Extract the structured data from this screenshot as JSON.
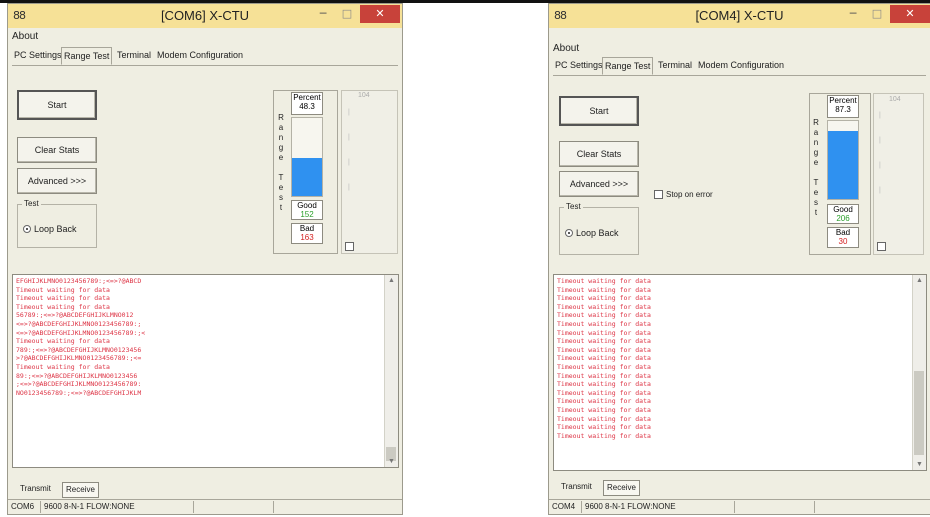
{
  "windows": [
    {
      "app_icon": "88",
      "title": "[COM6] X-CTU",
      "menu": "About",
      "tabs": [
        "PC Settings",
        "Range Test",
        "Terminal",
        "Modem Configuration"
      ],
      "buttons": {
        "start": "Start",
        "clear_stats": "Clear Stats",
        "advanced": "Advanced >>>"
      },
      "test_group": {
        "title": "Test",
        "loop_back": "Loop Back"
      },
      "range_test_label": [
        "R",
        "a",
        "n",
        "g",
        "e",
        "",
        "T",
        "e",
        "s",
        "t"
      ],
      "percent": {
        "label": "Percent",
        "value": "48.3",
        "fraction": 0.483
      },
      "good": {
        "label": "Good",
        "value": "152"
      },
      "bad": {
        "label": "Bad",
        "value": "163"
      },
      "top_num": "104",
      "terminal_lines": [
        "EFGHIJKLMNO0123456789:;<=>?@ABCD",
        "Timeout waiting for data",
        "Timeout waiting for data",
        "Timeout waiting for data",
        "56789:;<=>?@ABCDEFGHIJKLMNO012",
        "<=>?@ABCDEFGHIJKLMNO0123456789:;",
        "<=>?@ABCDEFGHIJKLMNO0123456789:;<",
        "Timeout waiting for data",
        "789:;<=>?@ABCDEFGHIJKLMNO0123456",
        ">?@ABCDEFGHIJKLMNO0123456789:;<=",
        "Timeout waiting for data",
        "89:;<=>?@ABCDEFGHIJKLMNO0123456",
        ";<=>?@ABCDEFGHIJKLMNO0123456789:",
        "NO0123456789:;<=>?@ABCDEFGHIJKLM"
      ],
      "bottom_tabs": [
        "Transmit",
        "Receive"
      ],
      "status": {
        "port": "COM6",
        "settings": "9600 8-N-1  FLOW:NONE"
      }
    },
    {
      "app_icon": "88",
      "title": "[COM4] X-CTU",
      "menu": "About",
      "tabs": [
        "PC Settings",
        "Range Test",
        "Terminal",
        "Modem Configuration"
      ],
      "buttons": {
        "start": "Start",
        "clear_stats": "Clear Stats",
        "advanced": "Advanced >>>"
      },
      "stop_on_error": "Stop on error",
      "test_group": {
        "title": "Test",
        "loop_back": "Loop Back"
      },
      "range_test_label": [
        "R",
        "a",
        "n",
        "g",
        "e",
        "",
        "T",
        "e",
        "s",
        "t"
      ],
      "percent": {
        "label": "Percent",
        "value": "87.3",
        "fraction": 0.873
      },
      "good": {
        "label": "Good",
        "value": "206"
      },
      "bad": {
        "label": "Bad",
        "value": "30"
      },
      "top_num": "104",
      "terminal_lines": [
        "Timeout waiting for data",
        "Timeout waiting for data",
        "Timeout waiting for data",
        "Timeout waiting for data",
        "Timeout waiting for data",
        "Timeout waiting for data",
        "Timeout waiting for data",
        "Timeout waiting for data",
        "Timeout waiting for data",
        "Timeout waiting for data",
        "Timeout waiting for data",
        "Timeout waiting for data",
        "Timeout waiting for data",
        "Timeout waiting for data",
        "Timeout waiting for data",
        "Timeout waiting for data",
        "Timeout waiting for data",
        "Timeout waiting for data",
        "Timeout waiting for data"
      ],
      "bottom_tabs": [
        "Transmit",
        "Receive"
      ],
      "status": {
        "port": "COM4",
        "settings": "9600 8-N-1  FLOW:NONE"
      }
    }
  ],
  "icons": [
    "app-icon",
    "minimize-icon",
    "maximize-icon",
    "close-icon",
    "scroll-up-icon",
    "scroll-down-icon"
  ],
  "colors": {
    "title_bar": "#f6e197",
    "close": "#c8423a",
    "bar_fill": "#2f91f0",
    "terminal_text": "#dd3344",
    "good": "#2aa02a",
    "bad": "#d42020"
  }
}
